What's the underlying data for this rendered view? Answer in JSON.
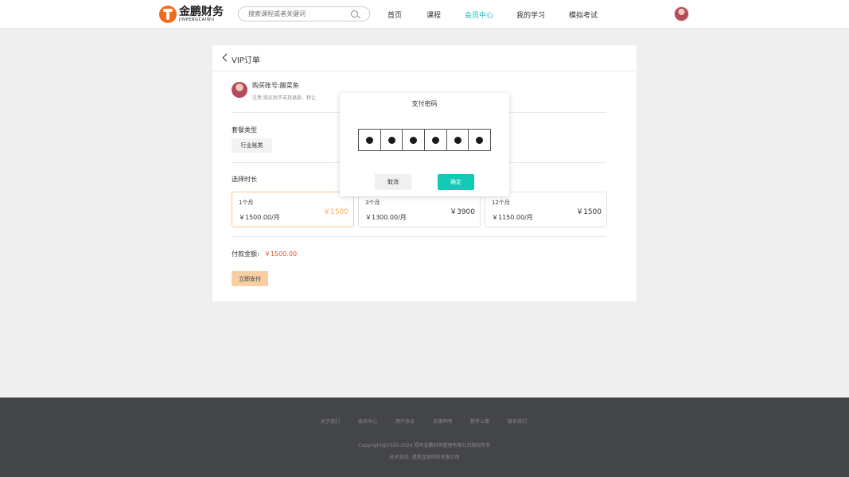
{
  "header": {
    "logo_cn": "金鹏财务",
    "logo_en": "JINPENGCAIWU",
    "search_placeholder": "搜索课程或者关键词",
    "nav": [
      {
        "label": "首页"
      },
      {
        "label": "课程"
      },
      {
        "label": "会员中心"
      },
      {
        "label": "我的学习"
      },
      {
        "label": "模拟考试"
      }
    ],
    "active_nav": "会员中心",
    "accent_color": "#13c0b6"
  },
  "order": {
    "title": "VIP订单",
    "account_label": "购买账号:酸菜鱼",
    "note": "注意:购买后不支持退款、转让",
    "package_type_label": "套餐类型",
    "package_tag": "行业账类",
    "duration_label": "选择时长",
    "durations": [
      {
        "name": "1个月",
        "per_month": "￥1500.00/月",
        "total": "￥1500",
        "selected": true
      },
      {
        "name": "3个月",
        "per_month": "￥1300.00/月",
        "total": "￥3900",
        "selected": false
      },
      {
        "name": "12个月",
        "per_month": "￥1150.00/月",
        "total": "￥1500",
        "selected": false
      }
    ],
    "pay_label": "付款金额:",
    "pay_amount": "￥1500.00",
    "pay_button": "立即支付"
  },
  "modal": {
    "title": "支付密码",
    "password_digits_filled": 6,
    "cancel_label": "取消",
    "confirm_label": "确定",
    "confirm_color": "#13c9b8"
  },
  "footer": {
    "links": [
      "关于我们",
      "会员中心",
      "用户协议",
      "法律声明",
      "新手上路",
      "联系我们"
    ],
    "copyright": "Copyright@2020-2024 郑州金鹏财务管理有限公司版权所有",
    "tech_support": "技术支持:  透视互联科技有限公司"
  }
}
